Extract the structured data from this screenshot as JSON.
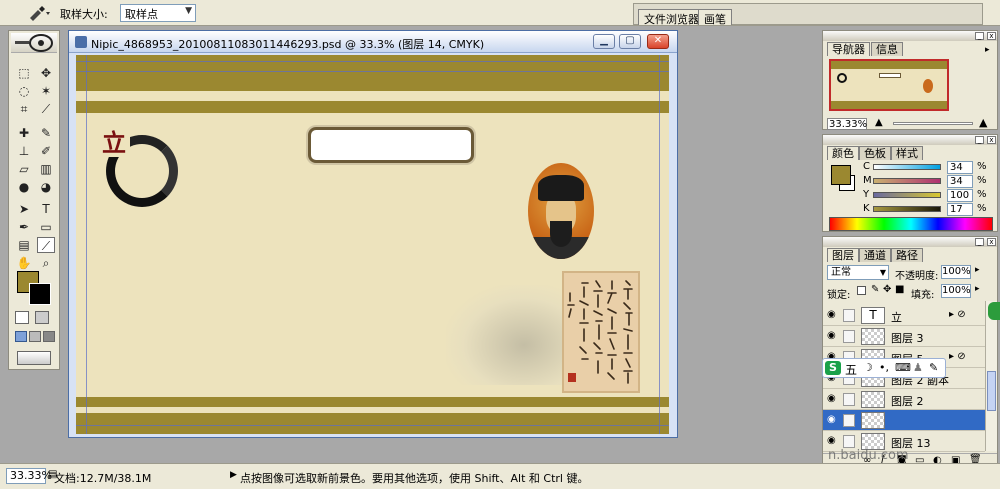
{
  "options_bar": {
    "sample_size_label": "取样大小:",
    "sample_size_value": "取样点",
    "well_tabs": [
      "文件浏览器",
      "画笔"
    ]
  },
  "toolbox": {
    "tools": [
      {
        "icon": "marquee-icon",
        "glyph": "⬚"
      },
      {
        "icon": "move-icon",
        "glyph": "✥"
      },
      {
        "icon": "lasso-icon",
        "glyph": "◌"
      },
      {
        "icon": "magic-wand-icon",
        "glyph": "✶"
      },
      {
        "icon": "crop-icon",
        "glyph": "⌗"
      },
      {
        "icon": "slice-icon",
        "glyph": "⟋"
      },
      {
        "icon": "healing-brush-icon",
        "glyph": "✚"
      },
      {
        "icon": "brush-icon",
        "glyph": "✎"
      },
      {
        "icon": "clone-stamp-icon",
        "glyph": "⊥"
      },
      {
        "icon": "history-brush-icon",
        "glyph": "✐"
      },
      {
        "icon": "eraser-icon",
        "glyph": "▱"
      },
      {
        "icon": "gradient-icon",
        "glyph": "▥"
      },
      {
        "icon": "blur-icon",
        "glyph": "●"
      },
      {
        "icon": "dodge-icon",
        "glyph": "◕"
      },
      {
        "icon": "path-select-icon",
        "glyph": "➤"
      },
      {
        "icon": "type-icon",
        "glyph": "T"
      },
      {
        "icon": "pen-icon",
        "glyph": "✒"
      },
      {
        "icon": "shape-icon",
        "glyph": "▭"
      },
      {
        "icon": "notes-icon",
        "glyph": "▤"
      },
      {
        "icon": "eyedropper-icon",
        "glyph": "⟋"
      },
      {
        "icon": "hand-icon",
        "glyph": "✋"
      },
      {
        "icon": "zoom-icon",
        "glyph": "⌕"
      }
    ],
    "foreground_color": "#9b8830",
    "background_color": "#000000"
  },
  "document": {
    "title": "Nipic_4868953_20100811083011446293.psd @ 33.3% (图层 14, CMYK)",
    "canvas_char": "立",
    "band_color": "#9b8830",
    "paper_color": "#ede3bd"
  },
  "navigator": {
    "tabs": [
      "导航器",
      "信息"
    ],
    "zoom": "33.33%"
  },
  "color_panel": {
    "tabs": [
      "颜色",
      "色板",
      "样式"
    ],
    "channels": [
      {
        "label": "C",
        "value": "34",
        "unit": "%"
      },
      {
        "label": "M",
        "value": "34",
        "unit": "%"
      },
      {
        "label": "Y",
        "value": "100",
        "unit": "%"
      },
      {
        "label": "K",
        "value": "17",
        "unit": "%"
      }
    ]
  },
  "layers_panel": {
    "tabs": [
      "图层",
      "通道",
      "路径"
    ],
    "blend_mode": "正常",
    "opacity_label": "不透明度:",
    "opacity_value": "100%",
    "lock_label": "锁定:",
    "fill_label": "填充:",
    "fill_value": "100%",
    "layers": [
      {
        "name": "立",
        "type": "text",
        "fx": true
      },
      {
        "name": "图层 3",
        "type": "pixel",
        "fx": false
      },
      {
        "name": "图层 5",
        "type": "pixel",
        "fx": true
      },
      {
        "name": "图层 2 副本",
        "type": "pixel",
        "fx": false
      },
      {
        "name": "图层 2",
        "type": "pixel",
        "fx": false
      },
      {
        "name": "",
        "type": "pixel",
        "fx": false,
        "selected": true
      },
      {
        "name": "图层 13",
        "type": "pixel",
        "fx": false
      }
    ]
  },
  "ime": {
    "logo": "S",
    "mode": "五"
  },
  "status_bar": {
    "zoom": "33.33%",
    "doc_size": "文档:12.7M/38.1M",
    "hint": "点按图像可选取新前景色。要用其他选项，使用 Shift、Alt 和 Ctrl 键。"
  },
  "watermark": "n.baidu.com"
}
